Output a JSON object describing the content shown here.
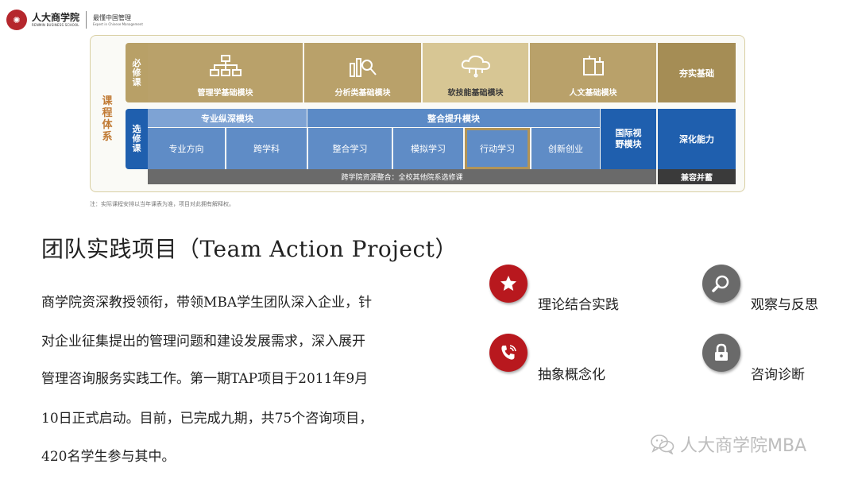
{
  "header": {
    "logo_cn": "人大商学院",
    "logo_en": "RENMIN BUSINESS SCHOOL",
    "tagline_cn": "最懂中国管理",
    "tagline_en": "Expert in Chinese Management",
    "seal_icon": "renmin-seal-icon",
    "brand_color": "#b5272d"
  },
  "diagram": {
    "side_label": "课程体系",
    "required": {
      "tag": "必修课",
      "modules": [
        {
          "label": "管理学基础模块",
          "icon": "org-chart-icon"
        },
        {
          "label": "分析类基础模块",
          "icon": "bar-chart-search-icon"
        },
        {
          "label": "软技能基础模块",
          "icon": "cloud-network-icon"
        },
        {
          "label": "人文基础模块",
          "icon": "culture-icon"
        }
      ],
      "outcome": "夯实基础",
      "color": "#b9a16a"
    },
    "elective": {
      "tag": "选修课",
      "group_depth": "专业纵深模块",
      "group_integration": "整合提升模块",
      "cells": [
        "专业方向",
        "跨学科",
        "整合学习",
        "模拟学习",
        "行动学习",
        "创新创业"
      ],
      "highlighted_cell": "行动学习",
      "international": "国际视野模块",
      "outcome": "深化能力",
      "color": "#1f5fae"
    },
    "cross_school": "跨学院资源整合：全校其他院系选修课",
    "compat": "兼容并蓄"
  },
  "note": "注：实际课程安排以当年课表为准，项目对此拥有解释权。",
  "title": "团队实践项目（Team Action Project）",
  "paragraph_lines": [
    "商学院资深教授领衔，带领MBA学生团队深入企业，针",
    "对企业征集提出的管理问题和建设发展需求，深入展开",
    "管理咨询服务实践工作。第一期TAP项目于2011年9月",
    "10日正式启动。目前，已完成九期，共75个咨询项目，",
    "420名学生参与其中。"
  ],
  "features": [
    {
      "label": "理论结合实践",
      "icon": "star-icon",
      "color": "#b8181e"
    },
    {
      "label": "观察与反思",
      "icon": "magnifier-icon",
      "color": "#6a6a6a"
    },
    {
      "label": "抽象概念化",
      "icon": "phone-icon",
      "color": "#b8181e"
    },
    {
      "label": "咨询诊断",
      "icon": "lock-icon",
      "color": "#6a6a6a"
    }
  ],
  "watermark": {
    "text": "人大商学院MBA",
    "icon": "wechat-icon"
  }
}
